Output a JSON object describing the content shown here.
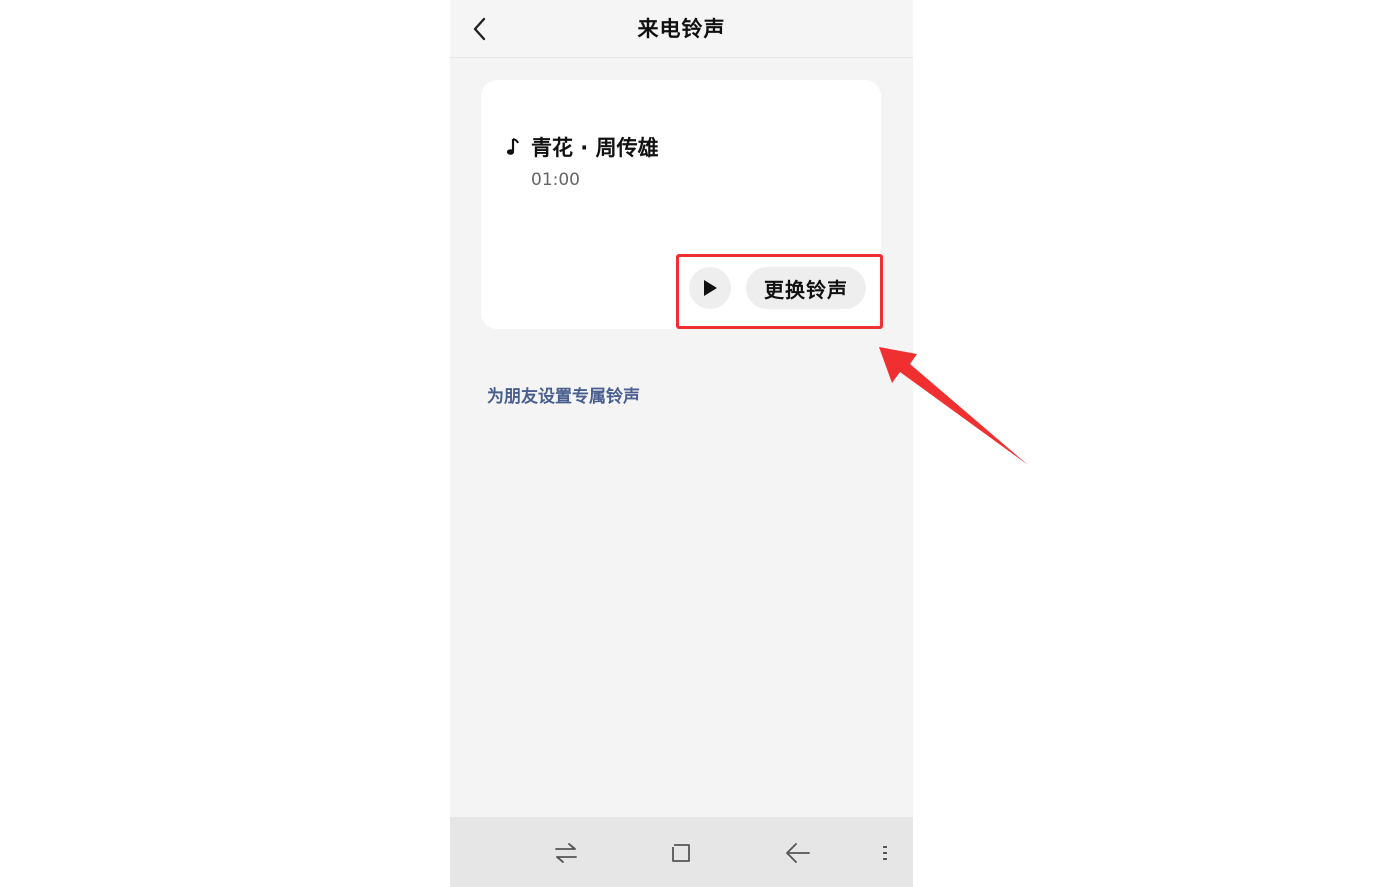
{
  "header": {
    "title": "来电铃声",
    "back_icon": "chevron-left-icon"
  },
  "ringtone": {
    "note_icon": "music-note-icon",
    "title": "青花 · 周传雄",
    "duration": "01:00",
    "play_icon": "play-icon",
    "change_label": "更换铃声"
  },
  "friends_link": "为朋友设置专属铃声",
  "nav": {
    "items": [
      "switch-icon",
      "square-icon",
      "back-arrow-icon",
      "menu-icon"
    ]
  },
  "annotation": {
    "highlight_color": "#f03030",
    "arrow_color": "#f03030"
  },
  "colors": {
    "background": "#f4f4f4",
    "card": "#ffffff",
    "link": "#4a5f8f"
  }
}
